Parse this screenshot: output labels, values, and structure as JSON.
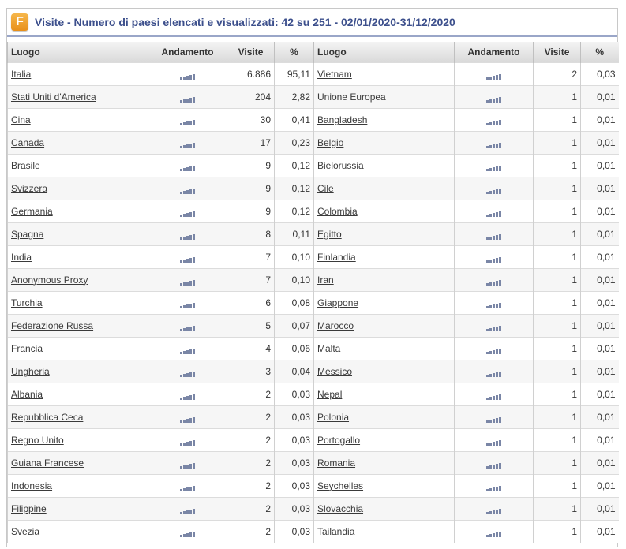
{
  "panel": {
    "logo_letter": "F",
    "title": "Visite - Numero di paesi elencati e visualizzati: 42 su 251 - 02/01/2020-31/12/2020"
  },
  "headers": {
    "place": "Luogo",
    "trend": "Andamento",
    "visits": "Visite",
    "percent": "%"
  },
  "trend_icon": "bar-chart-icon",
  "colors": {
    "title": "#3c4f8c",
    "logo": "#f0a030",
    "trend_bars": "#7a86a6"
  },
  "left_rows": [
    {
      "place": "Italia",
      "visits": "6.886",
      "percent": "95,11",
      "link": true
    },
    {
      "place": "Stati Uniti d'America",
      "visits": "204",
      "percent": "2,82",
      "link": true
    },
    {
      "place": "Cina",
      "visits": "30",
      "percent": "0,41",
      "link": true
    },
    {
      "place": "Canada",
      "visits": "17",
      "percent": "0,23",
      "link": true
    },
    {
      "place": "Brasile",
      "visits": "9",
      "percent": "0,12",
      "link": true
    },
    {
      "place": "Svizzera",
      "visits": "9",
      "percent": "0,12",
      "link": true
    },
    {
      "place": "Germania",
      "visits": "9",
      "percent": "0,12",
      "link": true
    },
    {
      "place": "Spagna",
      "visits": "8",
      "percent": "0,11",
      "link": true
    },
    {
      "place": "India",
      "visits": "7",
      "percent": "0,10",
      "link": true
    },
    {
      "place": "Anonymous Proxy",
      "visits": "7",
      "percent": "0,10",
      "link": true
    },
    {
      "place": "Turchia",
      "visits": "6",
      "percent": "0,08",
      "link": true
    },
    {
      "place": "Federazione Russa",
      "visits": "5",
      "percent": "0,07",
      "link": true
    },
    {
      "place": "Francia",
      "visits": "4",
      "percent": "0,06",
      "link": true
    },
    {
      "place": "Ungheria",
      "visits": "3",
      "percent": "0,04",
      "link": true
    },
    {
      "place": "Albania",
      "visits": "2",
      "percent": "0,03",
      "link": true
    },
    {
      "place": "Repubblica Ceca",
      "visits": "2",
      "percent": "0,03",
      "link": true
    },
    {
      "place": "Regno Unito",
      "visits": "2",
      "percent": "0,03",
      "link": true
    },
    {
      "place": "Guiana Francese",
      "visits": "2",
      "percent": "0,03",
      "link": true
    },
    {
      "place": "Indonesia",
      "visits": "2",
      "percent": "0,03",
      "link": true
    },
    {
      "place": "Filippine",
      "visits": "2",
      "percent": "0,03",
      "link": true
    },
    {
      "place": "Svezia",
      "visits": "2",
      "percent": "0,03",
      "link": true
    }
  ],
  "right_rows": [
    {
      "place": "Vietnam",
      "visits": "2",
      "percent": "0,03",
      "link": true
    },
    {
      "place": "Unione Europea",
      "visits": "1",
      "percent": "0,01",
      "link": false
    },
    {
      "place": "Bangladesh",
      "visits": "1",
      "percent": "0,01",
      "link": true
    },
    {
      "place": "Belgio",
      "visits": "1",
      "percent": "0,01",
      "link": true
    },
    {
      "place": "Bielorussia",
      "visits": "1",
      "percent": "0,01",
      "link": true
    },
    {
      "place": "Cile",
      "visits": "1",
      "percent": "0,01",
      "link": true
    },
    {
      "place": "Colombia",
      "visits": "1",
      "percent": "0,01",
      "link": true
    },
    {
      "place": "Egitto",
      "visits": "1",
      "percent": "0,01",
      "link": true
    },
    {
      "place": "Finlandia",
      "visits": "1",
      "percent": "0,01",
      "link": true
    },
    {
      "place": "Iran",
      "visits": "1",
      "percent": "0,01",
      "link": true
    },
    {
      "place": "Giappone",
      "visits": "1",
      "percent": "0,01",
      "link": true
    },
    {
      "place": "Marocco",
      "visits": "1",
      "percent": "0,01",
      "link": true
    },
    {
      "place": "Malta",
      "visits": "1",
      "percent": "0,01",
      "link": true
    },
    {
      "place": "Messico",
      "visits": "1",
      "percent": "0,01",
      "link": true
    },
    {
      "place": "Nepal",
      "visits": "1",
      "percent": "0,01",
      "link": true
    },
    {
      "place": "Polonia",
      "visits": "1",
      "percent": "0,01",
      "link": true
    },
    {
      "place": "Portogallo",
      "visits": "1",
      "percent": "0,01",
      "link": true
    },
    {
      "place": "Romania",
      "visits": "1",
      "percent": "0,01",
      "link": true
    },
    {
      "place": "Seychelles",
      "visits": "1",
      "percent": "0,01",
      "link": true
    },
    {
      "place": "Slovacchia",
      "visits": "1",
      "percent": "0,01",
      "link": true
    },
    {
      "place": "Tailandia",
      "visits": "1",
      "percent": "0,01",
      "link": true
    }
  ]
}
